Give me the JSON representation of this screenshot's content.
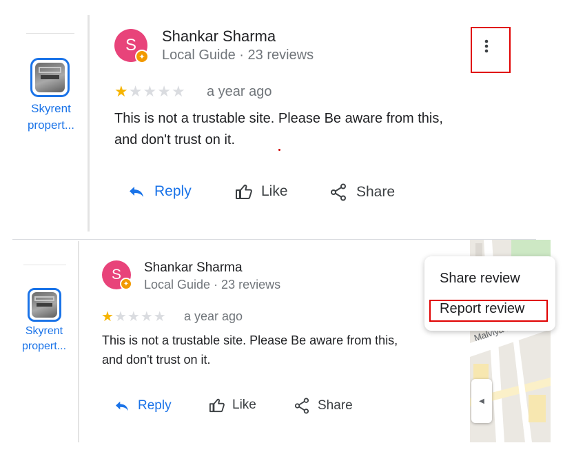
{
  "panel_top": {
    "side": {
      "place_label": "Skyrent propert..."
    },
    "review": {
      "avatar_letter": "S",
      "author": "Shankar Sharma",
      "meta": "Local Guide · 23 reviews",
      "rating": 1,
      "rating_max": 5,
      "when": "a year ago",
      "text_line1": "This is not a trustable site. Please Be aware from this,",
      "text_line2": "and don't trust on it.",
      "actions": {
        "reply": "Reply",
        "like": "Like",
        "share": "Share"
      },
      "more_icon": "more-vert-icon"
    }
  },
  "panel_bottom": {
    "side": {
      "place_label": "Skyrent propert..."
    },
    "review": {
      "avatar_letter": "S",
      "author": "Shankar Sharma",
      "meta": "Local Guide · 23 reviews",
      "rating": 1,
      "rating_max": 5,
      "when": "a year ago",
      "text_line1": "This is not a trustable site. Please Be aware from this,",
      "text_line2": "and don't trust on it.",
      "actions": {
        "reply": "Reply",
        "like": "Like",
        "share": "Share"
      }
    },
    "menu": {
      "share_review": "Share review",
      "report_review": "Report review"
    },
    "map": {
      "street_label": "Malviya Nag"
    }
  },
  "colors": {
    "accent": "#1a73e8",
    "avatar": "#e8437a",
    "badge": "#f29900",
    "star_on": "#f6b400",
    "star_off": "#dadce0",
    "highlight": "#e00000"
  }
}
